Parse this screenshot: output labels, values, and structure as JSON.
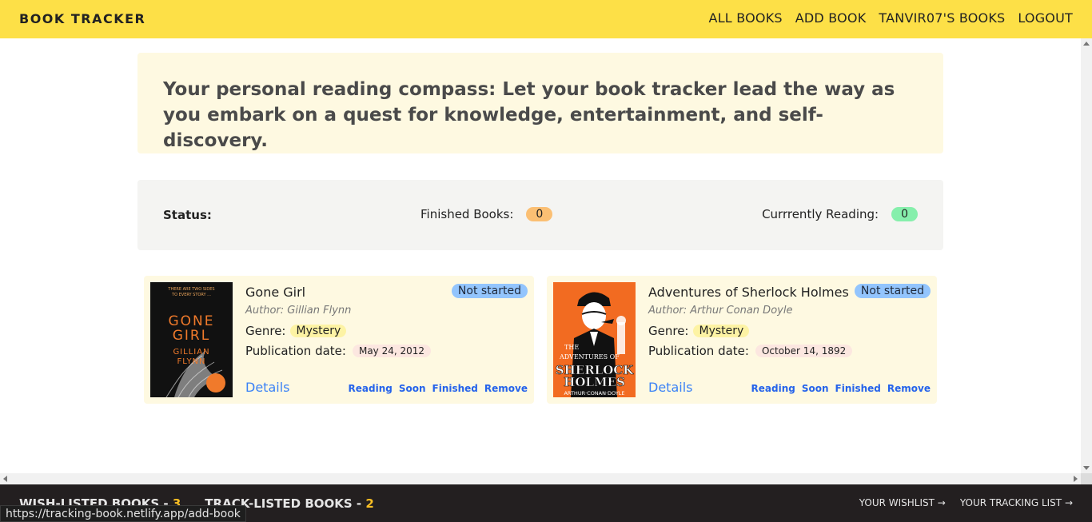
{
  "header": {
    "brand": "BOOK TRACKER",
    "nav": [
      "ALL BOOKS",
      "ADD BOOK",
      "TANVIR07'S BOOKS",
      "LOGOUT"
    ]
  },
  "hero": {
    "text": "Your personal reading compass: Let your book tracker lead the way as you embark on a quest for knowledge, entertainment, and self-discovery."
  },
  "status": {
    "label": "Status:",
    "finished_label": "Finished Books:",
    "finished_count": "0",
    "reading_label": "Currrently Reading:",
    "reading_count": "0"
  },
  "books": [
    {
      "title": "Gone Girl",
      "author": "Author: Gillian Flynn",
      "genre_label": "Genre:",
      "genre": "Mystery",
      "pub_label": "Publication date:",
      "pub_date": "May 24, 2012",
      "status": "Not started",
      "details": "Details",
      "actions": [
        "Reading",
        "Soon",
        "Finished",
        "Remove"
      ],
      "cover_text": [
        "THERE ARE TWO SIDES",
        "TO EVERY STORY ...",
        "GONE",
        "GIRL",
        "GILLIAN",
        "FLYNN"
      ]
    },
    {
      "title": "Adventures of Sherlock Holmes",
      "author": "Author: Arthur Conan Doyle",
      "genre_label": "Genre:",
      "genre": "Mystery",
      "pub_label": "Publication date:",
      "pub_date": "October 14, 1892",
      "status": "Not started",
      "details": "Details",
      "actions": [
        "Reading",
        "Soon",
        "Finished",
        "Remove"
      ],
      "cover_text": [
        "THE",
        "ADVENTURES OF",
        "SHERLOCK",
        "HOLMES",
        "ARTHUR·CONAN·DOYLE"
      ]
    }
  ],
  "footer": {
    "wishlisted_label": "WISH-LISTED BOOKS -",
    "wishlisted_count": "3",
    "tracklisted_label": "TRACK-LISTED BOOKS -",
    "tracklisted_count": "2",
    "links": [
      "YOUR WISHLIST →",
      "YOUR TRACKING LIST →"
    ]
  },
  "status_url": "https://tracking-book.netlify.app/add-book",
  "colors": {
    "header_bg": "#fde047",
    "card_bg": "#fef9e1",
    "badge": "#93c5fd",
    "finished_pill": "#fbbf73",
    "reading_pill": "#86efac",
    "footer_bg": "#231f20"
  }
}
